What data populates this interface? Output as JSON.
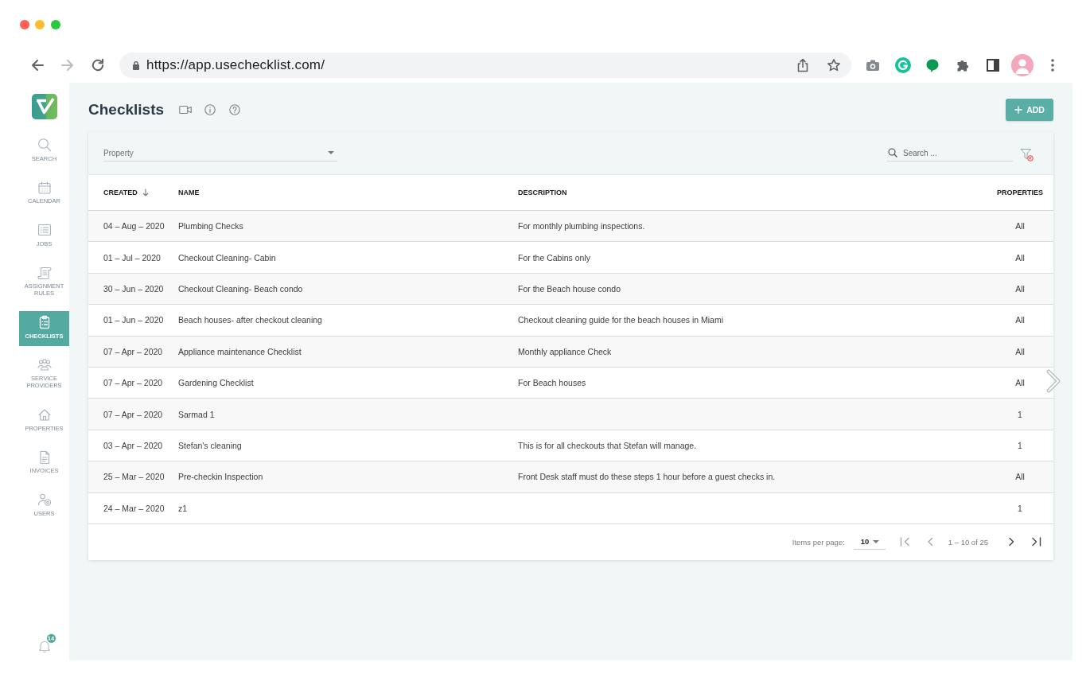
{
  "browser": {
    "nav_buttons": [
      {
        "kind": "back",
        "disabled": false
      },
      {
        "kind": "forward",
        "disabled": true
      }
    ],
    "url": "https://app.usechecklist.com/"
  },
  "sidebar": {
    "items": [
      {
        "label": "SEARCH",
        "selected": false
      },
      {
        "label": "CALENDAR",
        "selected": false
      },
      {
        "label": "JOBS",
        "selected": false
      },
      {
        "label": "ASSIGNMENT RULES",
        "selected": false
      },
      {
        "label": "CHECKLISTS",
        "selected": true
      },
      {
        "label": "SERVICE PROVIDERS",
        "selected": false
      },
      {
        "label": "PROPERTIES",
        "selected": false
      },
      {
        "label": "INVOICES",
        "selected": false
      },
      {
        "label": "USERS",
        "selected": false
      }
    ],
    "notification_count": "14"
  },
  "header": {
    "title": "Checklists",
    "add_button": "ADD"
  },
  "filters": {
    "property": {
      "placeholder": "Property"
    },
    "search": {
      "placeholder": "Search ..."
    }
  },
  "table": {
    "columns": [
      {
        "label": "CREATED",
        "sorted_descending": true
      },
      {
        "label": "NAME",
        "sorted_descending": false
      },
      {
        "label": "DESCRIPTION",
        "sorted_descending": false
      },
      {
        "label": "PROPERTIES",
        "sorted_descending": false
      }
    ],
    "rows": [
      {
        "created": "04 – Aug – 2020",
        "name": "Plumbing Checks",
        "description": "For monthly plumbing inspections.",
        "properties": "All"
      },
      {
        "created": "01 – Jul – 2020",
        "name": "Checkout Cleaning- Cabin",
        "description": "For the Cabins only",
        "properties": "All"
      },
      {
        "created": "30 – Jun – 2020",
        "name": "Checkout Cleaning- Beach condo",
        "description": "For the Beach house condo",
        "properties": "All"
      },
      {
        "created": "01 – Jun – 2020",
        "name": "Beach houses- after checkout cleaning",
        "description": "Checkout cleaning guide for the beach houses in Miami",
        "properties": "All"
      },
      {
        "created": "07 – Apr – 2020",
        "name": "Appliance maintenance Checklist",
        "description": "Monthly appliance Check",
        "properties": "All"
      },
      {
        "created": "07 – Apr – 2020",
        "name": "Gardening Checklist",
        "description": "For Beach houses",
        "properties": "All"
      },
      {
        "created": "07 – Apr – 2020",
        "name": "Sarmad 1",
        "properties": "1"
      },
      {
        "created": "03 – Apr – 2020",
        "name": "Stefan's cleaning",
        "description": "This is for all checkouts that Stefan will manage.",
        "properties": "1"
      },
      {
        "created": "25 – Mar – 2020",
        "name": "Pre-checkin Inspection",
        "description": "Front Desk staff must do these steps 1 hour before a guest checks in.",
        "properties": "All"
      },
      {
        "created": "24 – Mar – 2020",
        "name": "z1",
        "properties": "1"
      }
    ]
  },
  "pagination": {
    "items_per_page_label": "Items per page:",
    "page_size": "10",
    "back_buttons": [
      {
        "kind": "first",
        "disabled": true
      },
      {
        "kind": "previous",
        "disabled": true
      }
    ],
    "range": "1 – 10 of 25",
    "forward_buttons": [
      {
        "kind": "next",
        "disabled": false
      },
      {
        "kind": "last",
        "disabled": false
      }
    ]
  }
}
